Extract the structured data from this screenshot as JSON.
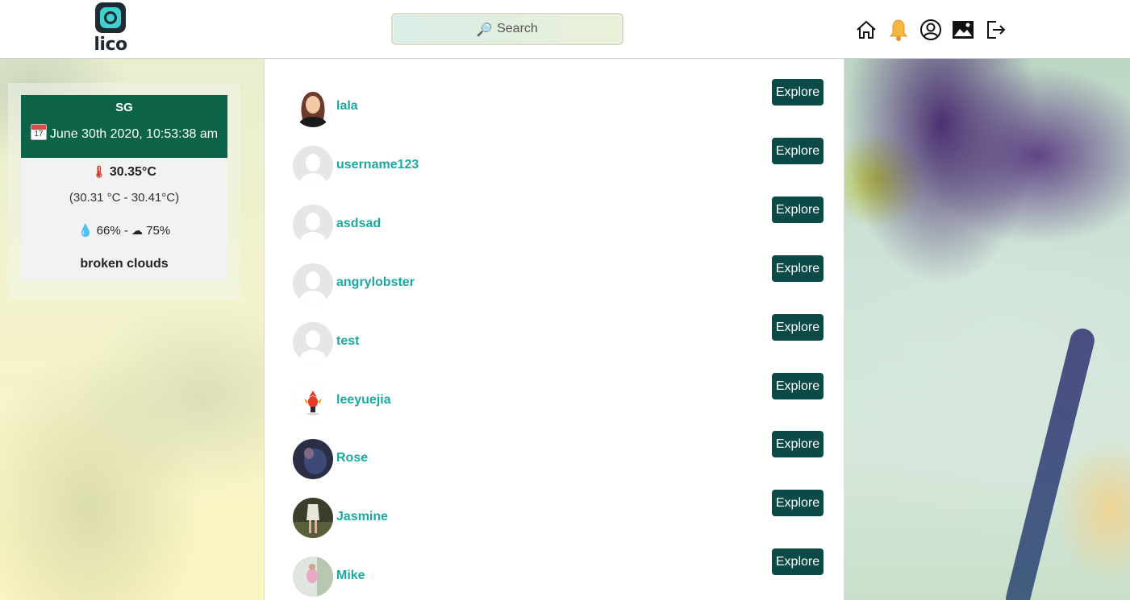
{
  "app": {
    "logo_text": "lico"
  },
  "search": {
    "placeholder": "Search"
  },
  "nav": {
    "icons": [
      "home-icon",
      "bell-icon",
      "profile-icon",
      "gallery-icon",
      "logout-icon"
    ]
  },
  "weather": {
    "city": "SG",
    "datetime": "June 30th 2020, 10:53:38 am",
    "calendar_day": "17",
    "temperature": "30.35°C",
    "range": "(30.31 °C - 30.41°C)",
    "humidity": "66%",
    "separator": "-",
    "cloudiness": "75%",
    "description": "broken clouds"
  },
  "users": [
    {
      "name": "lala",
      "avatar": "female-avatar",
      "action": "Explore"
    },
    {
      "name": "username123",
      "avatar": "default-avatar",
      "action": "Explore"
    },
    {
      "name": "asdsad",
      "avatar": "default-avatar",
      "action": "Explore"
    },
    {
      "name": "angrylobster",
      "avatar": "default-avatar",
      "action": "Explore"
    },
    {
      "name": "test",
      "avatar": "default-avatar",
      "action": "Explore"
    },
    {
      "name": "leeyuejia",
      "avatar": "bird-avatar",
      "action": "Explore"
    },
    {
      "name": "Rose",
      "avatar": "photo-avatar",
      "action": "Explore"
    },
    {
      "name": "Jasmine",
      "avatar": "photo-avatar",
      "action": "Explore"
    },
    {
      "name": "Mike",
      "avatar": "photo-avatar",
      "action": "Explore"
    }
  ],
  "colors": {
    "accent_teal": "#1aa9a1",
    "button_dark": "#0b4a47",
    "weather_header": "#0d6347"
  }
}
